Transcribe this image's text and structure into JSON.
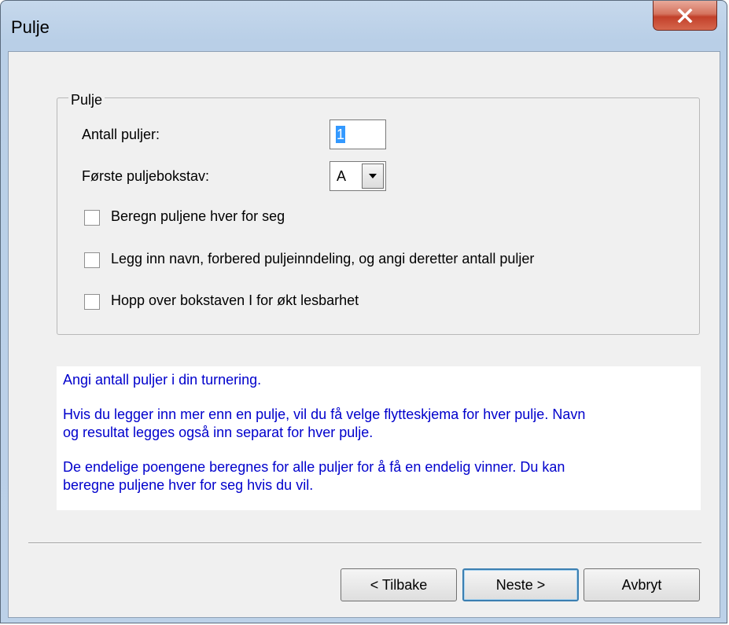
{
  "window": {
    "title": "Pulje",
    "close_icon": "close-icon"
  },
  "group": {
    "legend": "Pulje",
    "count_label": "Antall puljer:",
    "count_value": "1",
    "first_letter_label": "Første puljebokstav:",
    "first_letter_value": "A",
    "checkboxes": [
      {
        "label": "Beregn puljene hver for seg",
        "checked": false
      },
      {
        "label": "Legg inn navn, forbered puljeinndeling, og angi deretter antall puljer",
        "checked": false
      },
      {
        "label": "Hopp over bokstaven I for økt lesbarhet",
        "checked": false
      }
    ]
  },
  "info": {
    "line1": "Angi antall puljer i din turnering.",
    "line2": "Hvis du legger inn mer enn en pulje, vil du få velge flytteskjema for hver pulje. Navn",
    "line3": "og resultat legges også inn separat for hver pulje.",
    "line4": "De endelige poengene beregnes for alle puljer for å få en endelig vinner. Du kan",
    "line5": "beregne puljene hver for seg hvis du vil.",
    "color": "#0000cc"
  },
  "buttons": {
    "back": "< Tilbake",
    "next": "Neste >",
    "cancel": "Avbryt"
  }
}
